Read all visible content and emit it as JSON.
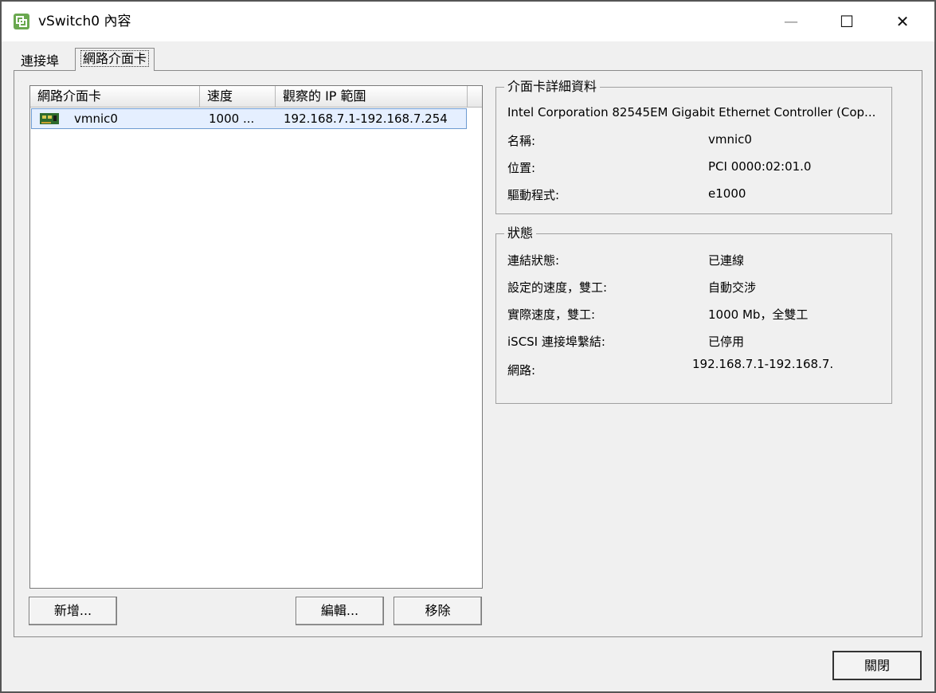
{
  "window": {
    "title": "vSwitch0 內容",
    "controls": {
      "minimize": "—",
      "maximize": "☐",
      "close": "✕"
    },
    "icon": "vsphere-app-icon"
  },
  "tabs": [
    {
      "label": "連接埠",
      "active": false
    },
    {
      "label": "網路介面卡",
      "active": true
    }
  ],
  "adapter_list": {
    "columns": [
      "網路介面卡",
      "速度",
      "觀察的 IP 範圍"
    ],
    "rows": [
      {
        "icon": "nic-icon",
        "name": "vmnic0",
        "speed": "1000 ...",
        "ip_range": "192.168.7.1-192.168.7.254",
        "selected": true
      }
    ]
  },
  "buttons": {
    "add": "新增...",
    "edit": "編輯...",
    "remove": "移除",
    "close": "關閉"
  },
  "details": {
    "legend": "介面卡詳細資料",
    "description": "Intel Corporation 82545EM Gigabit Ethernet Controller (Cop...",
    "fields": [
      {
        "label": "名稱:",
        "value": "vmnic0"
      },
      {
        "label": "位置:",
        "value": "PCI 0000:02:01.0"
      },
      {
        "label": "驅動程式:",
        "value": "e1000"
      }
    ]
  },
  "status": {
    "legend": "狀態",
    "fields": [
      {
        "label": "連結狀態:",
        "value": "已連線"
      },
      {
        "label": "設定的速度，雙工:",
        "value": "自動交涉"
      },
      {
        "label": "實際速度，雙工:",
        "value": "1000 Mb，全雙工"
      },
      {
        "label": "iSCSI 連接埠繫結:",
        "value": "已停用"
      },
      {
        "label": "網路:",
        "value": "192.168.7.1-192.168.7."
      }
    ]
  },
  "colors": {
    "selection_bg": "#e5efff",
    "selection_border": "#6e9bd1",
    "window_bg": "#f0f0f0"
  }
}
